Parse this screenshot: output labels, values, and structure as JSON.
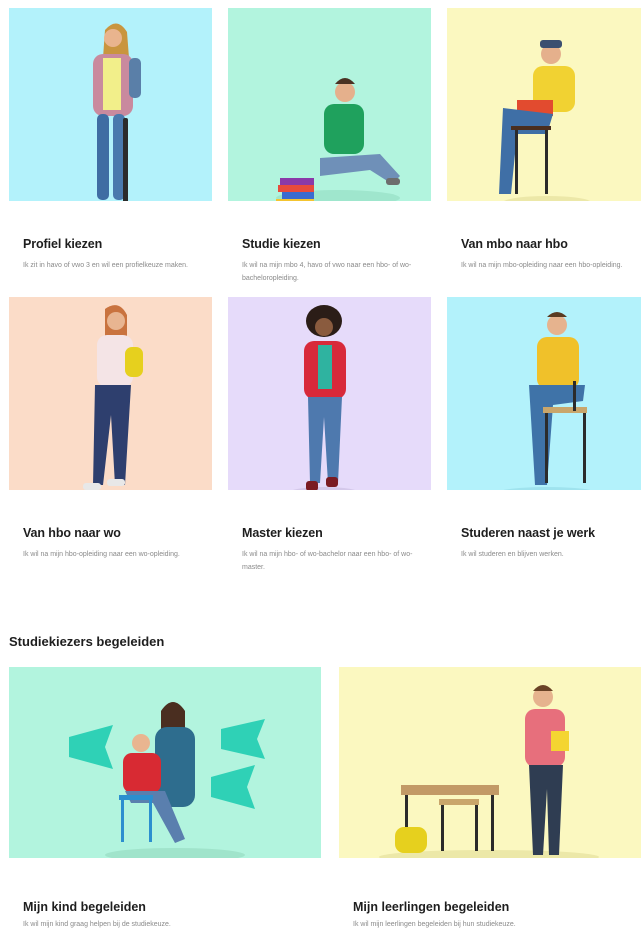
{
  "cards": [
    {
      "title": "Profiel kiezen",
      "desc": "Ik zit in havo of vwo 3 en wil een profielkeuze maken.",
      "bg": "#b3f2fb"
    },
    {
      "title": "Studie kiezen",
      "desc": "Ik wil na mijn mbo 4, havo of vwo naar een hbo- of wo-bacheloropleiding.",
      "bg": "#b2f4de"
    },
    {
      "title": "Van mbo naar hbo",
      "desc": "Ik wil na mijn mbo-opleiding naar een hbo-opleiding.",
      "bg": "#fbf8c0"
    },
    {
      "title": "Van hbo naar wo",
      "desc": "Ik wil na mijn hbo-opleiding naar een wo-opleiding.",
      "bg": "#fbdcc8"
    },
    {
      "title": "Master kiezen",
      "desc": "Ik wil na mijn hbo- of wo-bachelor naar een hbo- of wo-master.",
      "bg": "#e6dbfa"
    },
    {
      "title": "Studeren naast je werk",
      "desc": "Ik wil studeren en blijven werken.",
      "bg": "#b3f2fb"
    }
  ],
  "section": {
    "title": "Studiekiezers begeleiden"
  },
  "big_cards": [
    {
      "title": "Mijn kind begeleiden",
      "desc": "Ik wil mijn kind graag helpen bij de studiekeuze.",
      "bg": "#b2f4de"
    },
    {
      "title": "Mijn leerlingen begeleiden",
      "desc": "Ik wil mijn leerlingen begeleiden bij hun studiekeuze.",
      "bg": "#fbf8c0"
    }
  ]
}
